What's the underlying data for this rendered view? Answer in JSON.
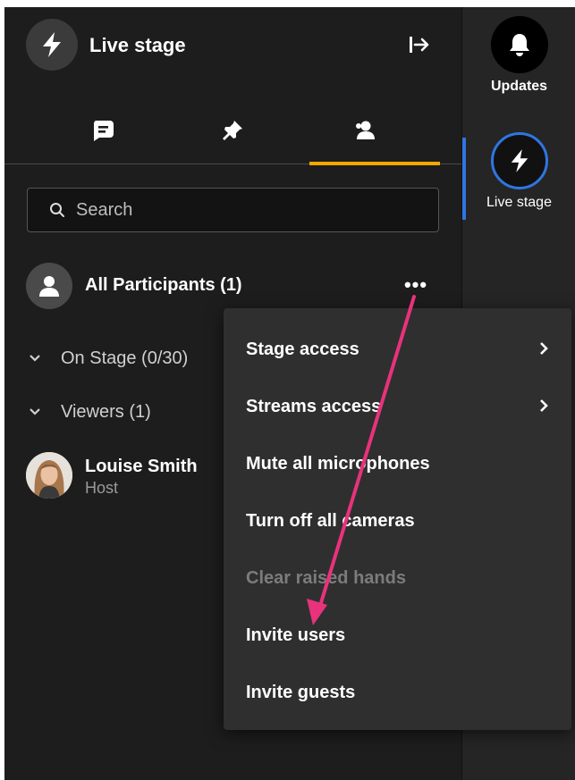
{
  "header": {
    "title": "Live stage"
  },
  "tabs": [
    {
      "name": "chat",
      "icon": "chat-icon"
    },
    {
      "name": "pinned",
      "icon": "pin-icon"
    },
    {
      "name": "participants",
      "icon": "people-icon",
      "active": true
    }
  ],
  "search": {
    "placeholder": "Search",
    "value": ""
  },
  "participants": {
    "all_label": "All Participants (1)",
    "more_label": "•••",
    "groups": [
      {
        "label": "On Stage (0/30)"
      },
      {
        "label": "Viewers (1)"
      }
    ],
    "users": [
      {
        "name": "Louise Smith",
        "role": "Host"
      }
    ]
  },
  "menu": {
    "items": [
      {
        "label": "Stage access",
        "has_submenu": true,
        "disabled": false
      },
      {
        "label": "Streams access",
        "has_submenu": true,
        "disabled": false
      },
      {
        "label": "Mute all microphones",
        "has_submenu": false,
        "disabled": false
      },
      {
        "label": "Turn off all cameras",
        "has_submenu": false,
        "disabled": false
      },
      {
        "label": "Clear raised hands",
        "has_submenu": false,
        "disabled": true
      },
      {
        "label": "Invite users",
        "has_submenu": false,
        "disabled": false
      },
      {
        "label": "Invite guests",
        "has_submenu": false,
        "disabled": false
      }
    ]
  },
  "rail": {
    "updates_label": "Updates",
    "live_label": "Live stage"
  },
  "colors": {
    "accent_tab": "#f2a800",
    "rail_active": "#2f76e0",
    "annotation_arrow": "#e8327c"
  }
}
